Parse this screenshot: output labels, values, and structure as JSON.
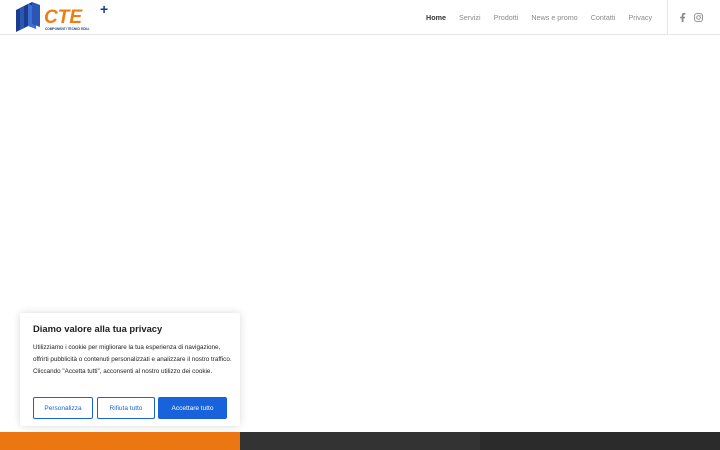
{
  "header": {
    "logo": {
      "text": "CTE",
      "plus": "+",
      "subtitle": "COMPONENTI TECNICI EDILI"
    },
    "nav": [
      {
        "label": "Home",
        "active": true
      },
      {
        "label": "Servizi",
        "active": false
      },
      {
        "label": "Prodotti",
        "active": false
      },
      {
        "label": "News e promo",
        "active": false
      },
      {
        "label": "Contatti",
        "active": false
      },
      {
        "label": "Privacy",
        "active": false
      }
    ],
    "social": [
      "facebook-icon",
      "instagram-icon"
    ]
  },
  "cookie_banner": {
    "title": "Diamo valore alla tua privacy",
    "text": "Utilizziamo i cookie per migliorare la tua esperienza di navigazione, offrirti pubblicità o contenuti personalizzati e analizzare il nostro traffico. Cliccando \"Accetta tutti\", acconsenti al nostro utilizzo dei cookie.",
    "buttons": {
      "customize": "Personalizza",
      "reject": "Rifiuta tutto",
      "accept": "Accettare tutto"
    }
  },
  "colors": {
    "brand_orange": "#f07d12",
    "brand_blue": "#1c3d8c",
    "cookie_accent": "#1863dc",
    "footer_orange": "#ec7612",
    "footer_dark": "#333333",
    "footer_darker": "#2b2b2b"
  }
}
